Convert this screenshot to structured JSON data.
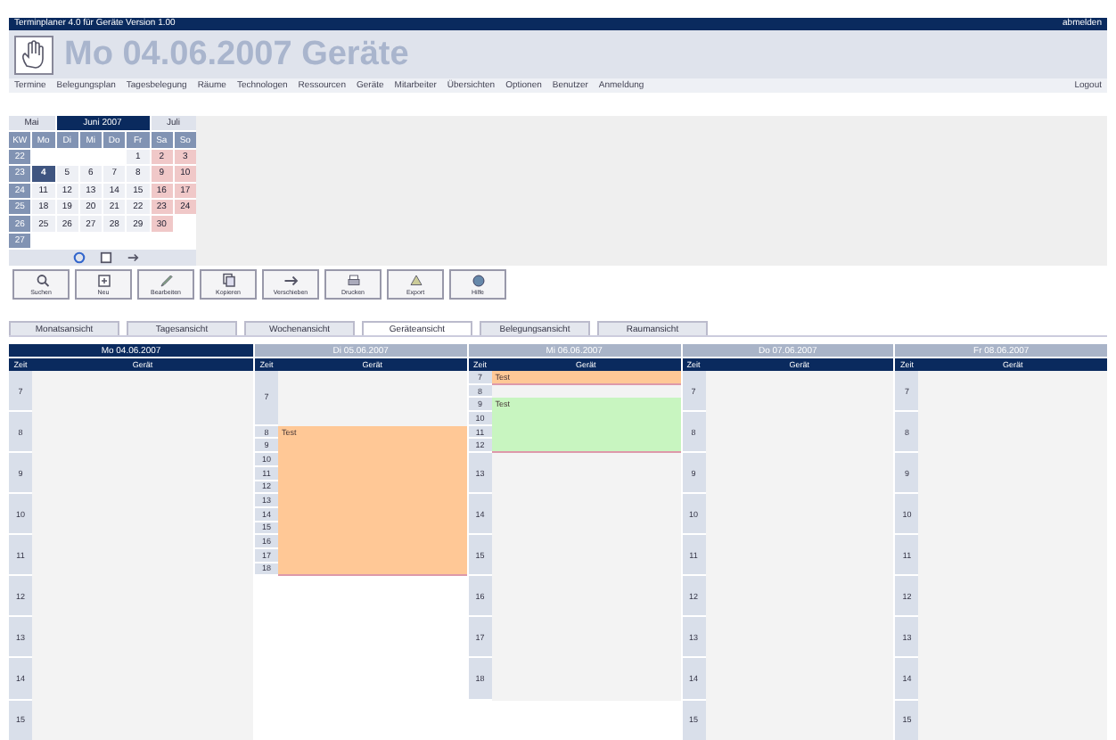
{
  "top_bar": {
    "title": "Terminplaner 4.0 für Geräte Version 1.00",
    "user": "abmelden"
  },
  "header": {
    "title": "Mo 04.06.2007 Geräte"
  },
  "menu": {
    "items": [
      "Termine",
      "Belegungsplan",
      "Tagesbelegung",
      "Räume",
      "Technologen",
      "Ressourcen",
      "Geräte",
      "Mitarbeiter",
      "Übersichten",
      "Optionen",
      "Benutzer",
      "Anmeldung"
    ],
    "logout": "Logout"
  },
  "calendar": {
    "prev": "Mai",
    "month": "Juni 2007",
    "next": "Juli",
    "weekdays": [
      "KW",
      "Mo",
      "Di",
      "Mi",
      "Do",
      "Fr",
      "Sa",
      "So"
    ],
    "weeks": [
      {
        "week": "22",
        "days": [
          {
            "kind": "blank"
          },
          {
            "kind": "blank"
          },
          {
            "kind": "blank"
          },
          {
            "kind": "blank"
          },
          {
            "label": "1",
            "kind": "day",
            "selected": false
          },
          {
            "label": "2",
            "kind": "weekend",
            "selected": false
          },
          {
            "label": "3",
            "kind": "weekend",
            "selected": false
          }
        ]
      },
      {
        "week": "23",
        "days": [
          {
            "label": "4",
            "kind": "day",
            "selected": true
          },
          {
            "label": "5",
            "kind": "day",
            "selected": false
          },
          {
            "label": "6",
            "kind": "day",
            "selected": false
          },
          {
            "label": "7",
            "kind": "day",
            "selected": false
          },
          {
            "label": "8",
            "kind": "day",
            "selected": false
          },
          {
            "label": "9",
            "kind": "weekend",
            "selected": false
          },
          {
            "label": "10",
            "kind": "weekend",
            "selected": false
          }
        ]
      },
      {
        "week": "24",
        "days": [
          {
            "label": "11",
            "kind": "day",
            "selected": false
          },
          {
            "label": "12",
            "kind": "day",
            "selected": false
          },
          {
            "label": "13",
            "kind": "day",
            "selected": false
          },
          {
            "label": "14",
            "kind": "day",
            "selected": false
          },
          {
            "label": "15",
            "kind": "day",
            "selected": false
          },
          {
            "label": "16",
            "kind": "weekend",
            "selected": false
          },
          {
            "label": "17",
            "kind": "weekend",
            "selected": false
          }
        ]
      },
      {
        "week": "25",
        "days": [
          {
            "label": "18",
            "kind": "day",
            "selected": false
          },
          {
            "label": "19",
            "kind": "day",
            "selected": false
          },
          {
            "label": "20",
            "kind": "day",
            "selected": false
          },
          {
            "label": "21",
            "kind": "day",
            "selected": false
          },
          {
            "label": "22",
            "kind": "day",
            "selected": false
          },
          {
            "label": "23",
            "kind": "weekend",
            "selected": false
          },
          {
            "label": "24",
            "kind": "weekend",
            "selected": false
          }
        ]
      },
      {
        "week": "26",
        "days": [
          {
            "label": "25",
            "kind": "day",
            "selected": false
          },
          {
            "label": "26",
            "kind": "day",
            "selected": false
          },
          {
            "label": "27",
            "kind": "day",
            "selected": false
          },
          {
            "label": "28",
            "kind": "day",
            "selected": false
          },
          {
            "label": "29",
            "kind": "day",
            "selected": false
          },
          {
            "label": "30",
            "kind": "weekend",
            "selected": false
          },
          {
            "kind": "blank"
          }
        ]
      },
      {
        "week": "27",
        "days": [
          {
            "kind": "blank"
          },
          {
            "kind": "blank"
          },
          {
            "kind": "blank"
          },
          {
            "kind": "blank"
          },
          {
            "kind": "blank"
          },
          {
            "kind": "blank"
          },
          {
            "kind": "blank"
          }
        ]
      }
    ]
  },
  "toolbar": [
    "Suchen",
    "Neu",
    "Bearbeiten",
    "Kopieren",
    "Verschieben",
    "Drucken",
    "Export",
    "Hilfe"
  ],
  "tabs": [
    {
      "label": "Monatsansicht",
      "selected": false
    },
    {
      "label": "Tagesansicht",
      "selected": false
    },
    {
      "label": "Wochenansicht",
      "selected": false
    },
    {
      "label": "Geräteansicht",
      "selected": true
    },
    {
      "label": "Belegungsansicht",
      "selected": false
    },
    {
      "label": "Raumansicht",
      "selected": false
    }
  ],
  "day_columns": [
    {
      "date": "Mo 04.06.2007",
      "selected": true,
      "headers": [
        "Zeit",
        "Gerät"
      ],
      "slots": [
        {
          "label": "7",
          "kind": "hour"
        },
        {
          "label": "8",
          "kind": "hour"
        },
        {
          "label": "9",
          "kind": "hour"
        },
        {
          "label": "10",
          "kind": "hour"
        },
        {
          "label": "11",
          "kind": "hour"
        },
        {
          "label": "12",
          "kind": "hour"
        },
        {
          "label": "13",
          "kind": "hour"
        },
        {
          "label": "14",
          "kind": "hour"
        },
        {
          "label": "15",
          "kind": "hour"
        }
      ]
    },
    {
      "date": "Di 05.06.2007",
      "selected": false,
      "headers": [
        "Zeit",
        "Gerät"
      ],
      "slots": [
        {
          "label": "7",
          "kind": "long"
        },
        {
          "kind": "booking",
          "label": "Test",
          "color": "#ffc896",
          "slots": [
            {
              "label": "8",
              "kind": "short"
            },
            {
              "label": "9",
              "kind": "short"
            },
            {
              "label": "10",
              "kind": "short"
            },
            {
              "label": "11",
              "kind": "short"
            },
            {
              "label": "12",
              "kind": "short"
            },
            {
              "label": "13",
              "kind": "short"
            },
            {
              "label": "14",
              "kind": "short"
            },
            {
              "label": "15",
              "kind": "short"
            },
            {
              "label": "16",
              "kind": "short"
            },
            {
              "label": "17",
              "kind": "short"
            },
            {
              "label": "18",
              "kind": "short"
            }
          ]
        }
      ]
    },
    {
      "date": "Mi 06.06.2007",
      "selected": false,
      "headers": [
        "Zeit",
        "Gerät"
      ],
      "slots": [
        {
          "kind": "booking",
          "label": "Test",
          "color": "#ffc896",
          "slots": [
            {
              "label": "7",
              "kind": "short"
            }
          ]
        },
        {
          "label": "8",
          "kind": "short"
        },
        {
          "kind": "booking",
          "label": "Test",
          "color": "#c8f5c0",
          "slots": [
            {
              "label": "9",
              "kind": "short"
            },
            {
              "label": "10",
              "kind": "short"
            },
            {
              "label": "11",
              "kind": "short"
            },
            {
              "label": "12",
              "kind": "short"
            }
          ]
        },
        {
          "label": "13",
          "kind": "hour"
        },
        {
          "label": "14",
          "kind": "hour"
        },
        {
          "label": "15",
          "kind": "hour"
        },
        {
          "label": "16",
          "kind": "hour"
        },
        {
          "label": "17",
          "kind": "hour"
        },
        {
          "label": "18",
          "kind": "hour"
        }
      ]
    },
    {
      "date": "Do 07.06.2007",
      "selected": false,
      "headers": [
        "Zeit",
        "Gerät"
      ],
      "slots": [
        {
          "label": "7",
          "kind": "hour"
        },
        {
          "label": "8",
          "kind": "hour"
        },
        {
          "label": "9",
          "kind": "hour"
        },
        {
          "label": "10",
          "kind": "hour"
        },
        {
          "label": "11",
          "kind": "hour"
        },
        {
          "label": "12",
          "kind": "hour"
        },
        {
          "label": "13",
          "kind": "hour"
        },
        {
          "label": "14",
          "kind": "hour"
        },
        {
          "label": "15",
          "kind": "hour"
        }
      ]
    },
    {
      "date": "Fr 08.06.2007",
      "selected": false,
      "headers": [
        "Zeit",
        "Gerät"
      ],
      "slots": [
        {
          "label": "7",
          "kind": "hour"
        },
        {
          "label": "8",
          "kind": "hour"
        },
        {
          "label": "9",
          "kind": "hour"
        },
        {
          "label": "10",
          "kind": "hour"
        },
        {
          "label": "11",
          "kind": "hour"
        },
        {
          "label": "12",
          "kind": "hour"
        },
        {
          "label": "13",
          "kind": "hour"
        },
        {
          "label": "14",
          "kind": "hour"
        },
        {
          "label": "15",
          "kind": "hour"
        }
      ]
    }
  ]
}
